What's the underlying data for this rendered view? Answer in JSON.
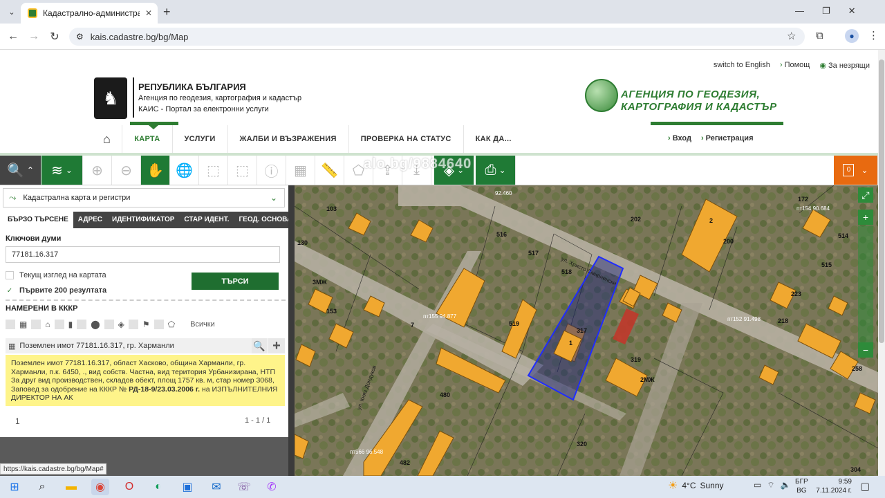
{
  "browser": {
    "tab_title": "Кадастрално-административн",
    "new_tab": "+",
    "url": "kais.cadastre.bg/bg/Map",
    "status_url": "https://kais.cadastre.bg/bg/Map#"
  },
  "header": {
    "top_links": [
      "switch to English",
      "Помощ",
      "За незрящи"
    ],
    "gov_title": "РЕПУБЛИКА БЪЛГАРИЯ",
    "gov_sub1": "Агенция по геодезия, картография и кадастър",
    "gov_sub2": "КАИС - Портал за електронни услуги",
    "agency_line1": "АГЕНЦИЯ ПО ГЕОДЕЗИЯ,",
    "agency_line2": "КАРТОГРАФИЯ И КАДАСТЪР",
    "nav": [
      "КАРТА",
      "УСЛУГИ",
      "ЖАЛБИ И ВЪЗРАЖЕНИЯ",
      "ПРОВЕРКА НА СТАТУС",
      "КАК ДА..."
    ],
    "login": "Вход",
    "register": "Регистрация"
  },
  "toolbar": {
    "cart_count": "0"
  },
  "panel": {
    "layer_title": "Кадастрална карта и регистри",
    "tabs": [
      "БЪРЗО ТЪРСЕНЕ",
      "АДРЕС",
      "ИДЕНТИФИКАТОР",
      "СТАР ИДЕНТ.",
      "ГЕОД. ОСНОВА"
    ],
    "keywords_label": "Ключови думи",
    "keywords_value": "77181.16.317",
    "current_view": "Текущ изглед на картата",
    "first200": "Първите 200 резултата",
    "search_button": "ТЪРСИ",
    "found_label": "НАМЕРЕНИ В КККР",
    "all_label": "Всички",
    "result_title": "Поземлен имот 77181.16.317, гр. Харманли",
    "result_text": "Поземлен имот 77181.16.317, област Хасково, община Харманли, гр. Харманли, п.к. 6450, ., вид собств. Частна, вид територия Урбанизирана, НТП За друг вид производствен, складов обект, площ 1757 кв. м, стар номер 3068,",
    "result_order_pre": "Заповед за одобрение на КККР №",
    "result_order_no": "РД-18-9/23.03.2006 г.",
    "result_order_post": "на ИЗПЪЛНИТЕЛНИЯ ДИРЕКТОР НА АК",
    "pager_page": "1",
    "pager_range": "1 - 1 / 1"
  },
  "map": {
    "watermark": "alo.bg/9884640",
    "parcel_labels": [
      "103",
      "130",
      "516",
      "517",
      "518",
      "519",
      "480",
      "482",
      "320",
      "319",
      "304",
      "258",
      "202",
      "200",
      "172",
      "514",
      "515",
      "223",
      "218",
      "153",
      "7",
      "317",
      "1",
      "2",
      "3МЖ",
      "2МЖ"
    ],
    "road_labels": [
      "ул. Христо Смирненски",
      "ул. Княз Дондуков"
    ],
    "geo_points": [
      "пт154 90.684",
      "пт152 91.498",
      "пт155 94.877",
      "пт566 96.548",
      "92.460"
    ],
    "zoom_in": "+",
    "zoom_out": "−"
  },
  "taskbar": {
    "temperature": "4°C",
    "weather": "Sunny",
    "lang1": "БГР",
    "lang2": "BG",
    "time": "9:59",
    "date": "7.11.2024 г."
  },
  "colors": {
    "brand_green": "#1f7a35",
    "accent_orange": "#e86a10",
    "result_yellow": "#fef48a"
  }
}
